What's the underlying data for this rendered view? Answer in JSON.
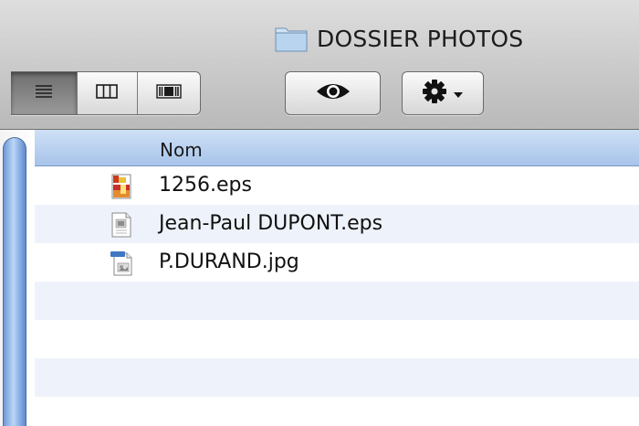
{
  "window": {
    "title": "DOSSIER PHOTOS",
    "title_icon": "folder-icon"
  },
  "toolbar": {
    "view_modes": [
      {
        "icon": "list-view-icon",
        "selected": true
      },
      {
        "icon": "column-view-icon",
        "selected": false
      },
      {
        "icon": "coverflow-view-icon",
        "selected": false
      }
    ],
    "quicklook_icon": "eye-icon",
    "action_icon": "gear-icon",
    "action_menu_icon": "chevron-down-icon"
  },
  "list": {
    "column_header": "Nom",
    "files": [
      {
        "name": "1256.eps",
        "icon": "eps-color-file-icon"
      },
      {
        "name": "Jean-Paul DUPONT.eps",
        "icon": "eps-document-icon"
      },
      {
        "name": "P.DURAND.jpg",
        "icon": "jpg-file-icon"
      }
    ]
  },
  "colors": {
    "header_blue": "#a8c4ea",
    "stripe": "#eef3fb",
    "scroll_thumb": "#8eb3e6"
  }
}
